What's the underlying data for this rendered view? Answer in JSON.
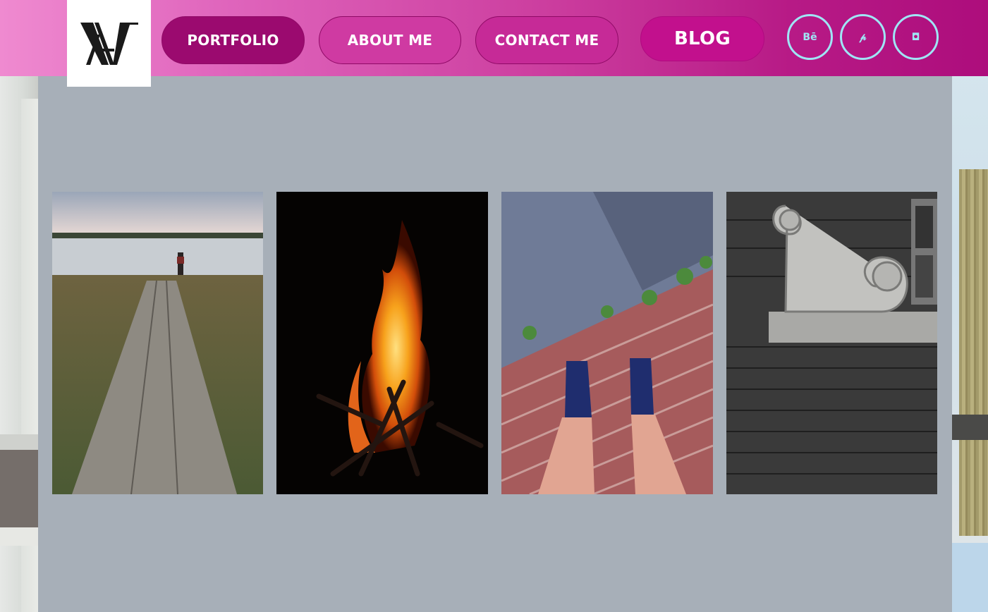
{
  "brand": {
    "logo_text": "AV",
    "logo_icon": "av-monogram-logo"
  },
  "nav": {
    "items": [
      {
        "label": "PORTFOLIO",
        "active": true
      },
      {
        "label": "ABOUT ME",
        "active": false
      },
      {
        "label": "CONTACT ME",
        "active": false
      },
      {
        "label": "BLOG",
        "active": false
      }
    ]
  },
  "social": [
    {
      "label": "Bē",
      "icon": "behance-icon"
    },
    {
      "label": "𝓅",
      "icon": "pinterest-icon"
    },
    {
      "label": "◘",
      "icon": "instagram-icon"
    }
  ],
  "gallery": {
    "photos": [
      {
        "subject": "boardwalk-path-to-water"
      },
      {
        "subject": "campfire-at-night"
      },
      {
        "subject": "sneakers-on-brick-pavement"
      },
      {
        "subject": "stone-scroll-ornament-brick-wall"
      }
    ]
  },
  "colors": {
    "header_gradient_start": "#ef8ad0",
    "header_gradient_end": "#ad0d7c",
    "active_nav": "#9b0a6f",
    "social_ring": "#9fe6f5",
    "panel_background": "#a7afb8"
  }
}
